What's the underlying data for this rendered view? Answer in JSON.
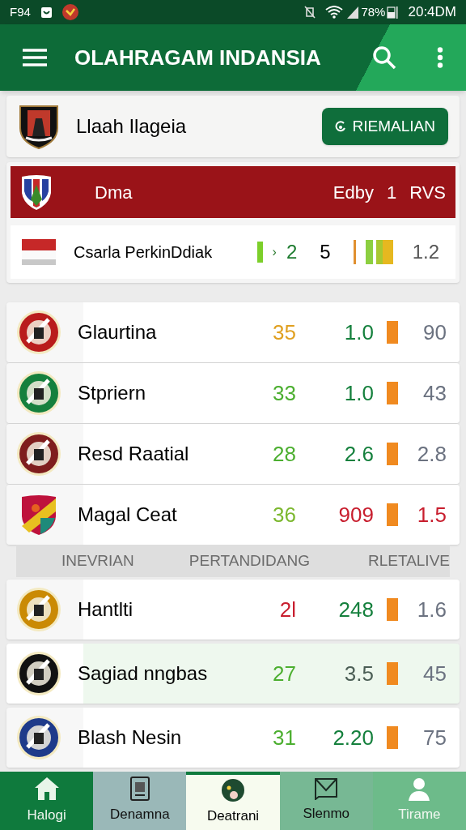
{
  "status_bar": {
    "carrier": "F94",
    "battery": "78%",
    "time": "20:4DM"
  },
  "app_bar": {
    "title": "OLAHRAGAM INDANSIA"
  },
  "club_card": {
    "name": "Llaah Ilageia",
    "button": "RIEMALIAN"
  },
  "featured": {
    "header": {
      "name": "Dma",
      "label": "Edby",
      "number": "1",
      "code": "RVS"
    },
    "row": {
      "name": "Csarla PerkinDdiak",
      "arrow": "›",
      "score_1": "2",
      "score_2": "5",
      "value": "1.2"
    }
  },
  "teams": [
    {
      "name": "Glaurtina",
      "kind": "circle",
      "color": "#b91c1c",
      "highlighted": false,
      "stats": [
        {
          "text": "35",
          "color": "#e0a020"
        },
        {
          "text": "1.0",
          "color": "#15803d"
        },
        {
          "text": "90",
          "color": "#6b7280"
        }
      ]
    },
    {
      "name": "Stpriern",
      "kind": "circle",
      "color": "#15803d",
      "highlighted": false,
      "stats": [
        {
          "text": "33",
          "color": "#4caf30"
        },
        {
          "text": "1.0",
          "color": "#15803d"
        },
        {
          "text": "43",
          "color": "#6b7280"
        }
      ]
    },
    {
      "name": "Resd Raatial",
      "kind": "circle",
      "color": "#7f1d1d",
      "highlighted": false,
      "stats": [
        {
          "text": "28",
          "color": "#4caf30"
        },
        {
          "text": "2.6",
          "color": "#15803d"
        },
        {
          "text": "2.8",
          "color": "#6b7280"
        }
      ]
    },
    {
      "name": "Magal Ceat",
      "kind": "shield",
      "color": "#be123c",
      "highlighted": false,
      "stats": [
        {
          "text": "36",
          "color": "#7cb82f"
        },
        {
          "text": "909",
          "color": "#c81e2e"
        },
        {
          "text": "1.5",
          "color": "#c81e2e"
        }
      ]
    }
  ],
  "columns": [
    "INEVRIAN",
    "PERTANDIDANG",
    "RLETALIVE"
  ],
  "teams_2": [
    {
      "name": "Hantlti",
      "kind": "circle",
      "color": "#ca8a04",
      "highlighted": false,
      "stats": [
        {
          "text": "2l",
          "color": "#c81e2e"
        },
        {
          "text": "248",
          "color": "#15803d"
        },
        {
          "text": "1.6",
          "color": "#6b7280"
        }
      ]
    },
    {
      "name": "Sagiad nngbas",
      "kind": "circle",
      "color": "#111111",
      "highlighted": true,
      "stats": [
        {
          "text": "27",
          "color": "#4caf30"
        },
        {
          "text": "3.5",
          "color": "#4b5e55"
        },
        {
          "text": "45",
          "color": "#6b7280"
        }
      ]
    },
    {
      "name": "Blash Nesin",
      "kind": "circle",
      "color": "#1e3a8a",
      "highlighted": false,
      "stats": [
        {
          "text": "31",
          "color": "#4caf30"
        },
        {
          "text": "2.20",
          "color": "#15803d"
        },
        {
          "text": "75",
          "color": "#6b7280"
        }
      ]
    }
  ],
  "bottom_nav": [
    {
      "label": "Halogi",
      "kind": "home",
      "color": "#0f7a3d",
      "selected": false
    },
    {
      "label": "Denamna",
      "kind": "document",
      "color": "#9ab8b8",
      "selected": false
    },
    {
      "label": "Deatrani",
      "kind": "ball",
      "color": "#f7fbef",
      "selected": true
    },
    {
      "label": "Slenmo",
      "kind": "envelope",
      "color": "#77b894",
      "selected": false
    },
    {
      "label": "Tirame",
      "kind": "person",
      "color": "#6dbb8a",
      "selected": false
    }
  ]
}
